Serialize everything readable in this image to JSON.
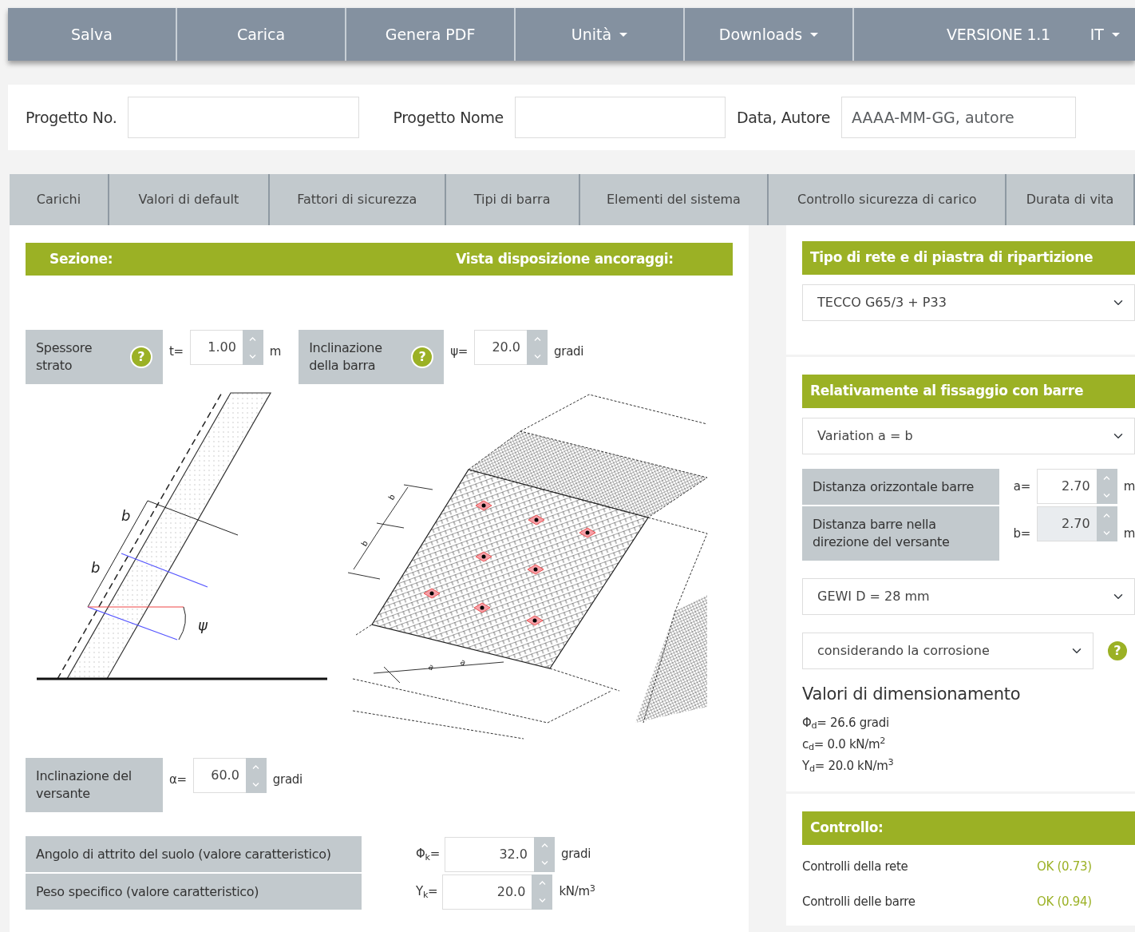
{
  "navbar": {
    "items": [
      {
        "label": "Salva",
        "kind": "button"
      },
      {
        "label": "Carica",
        "kind": "button"
      },
      {
        "label": "Genera PDF",
        "kind": "button"
      },
      {
        "label": "Unità",
        "kind": "dropdown"
      },
      {
        "label": "Downloads",
        "kind": "dropdown"
      }
    ],
    "version": "VERSIONE 1.1",
    "language": {
      "label": "IT",
      "kind": "dropdown"
    }
  },
  "project": {
    "fields": [
      {
        "label": "Progetto No."
      },
      {
        "label": "Progetto Nome"
      },
      {
        "label": "Data, Autore",
        "placeholder": "AAAA-MM-GG, autore"
      }
    ]
  },
  "tabs": [
    {
      "label": "Carichi",
      "selected": false
    },
    {
      "label": "Valori di default",
      "selected": false
    },
    {
      "label": "Fattori di sicurezza",
      "selected": false
    },
    {
      "label": "Tipi di barra",
      "selected": false
    },
    {
      "label": "Elementi del sistema",
      "selected": false
    },
    {
      "label": "Controllo sicurezza di carico",
      "selected": false
    },
    {
      "label": "Durata di vita",
      "selected": false
    }
  ],
  "left_panel": {
    "header": [
      "Sezione:",
      "Vista disposizione ancoraggi:"
    ],
    "params": [
      {
        "label": "Spessore strato",
        "help": "?",
        "symbol": "t=",
        "value": "1.00",
        "unit": "m"
      },
      {
        "label": "Inclinazione della barra",
        "help": "?",
        "symbol": "ψ=",
        "value": "20.0",
        "unit": "gradi"
      }
    ],
    "section_drawing": {
      "labels": [
        "b",
        "b",
        "ψ"
      ]
    },
    "layout_drawing": {
      "labels": [
        "b",
        "b",
        "a",
        "a"
      ]
    },
    "slope": {
      "label": "Inclinazione del versante",
      "symbol": "α=",
      "value": "60.0",
      "unit": "gradi"
    },
    "soil": [
      {
        "label": "Angolo di attrito del suolo (valore caratteristico)",
        "symbol": "Φ$_{k}$=",
        "value": "32.0",
        "unit": "gradi"
      },
      {
        "label": "Peso specifico (valore caratteristico)",
        "symbol": "Y$_{k}$=",
        "value": "20.0",
        "unit": "kN/m$^{3}$"
      }
    ]
  },
  "mesh": {
    "title": "Tipo di rete e di piastra di ripartizione",
    "selection": "TECCO G65/3 + P33"
  },
  "fixing": {
    "title": "Relativamente al fissaggio con barre",
    "variation": "Variation a = b",
    "distances": [
      {
        "label": "Distanza orizzontale barre",
        "symbol": "a=",
        "value": "2.70",
        "unit": "m",
        "disabled": false
      },
      {
        "label": "Distanza barre nella direzione del versante",
        "symbol": "b=",
        "value": "2.70",
        "unit": "m",
        "disabled": true
      }
    ],
    "bar": "GEWI D = 28 mm",
    "corrosion": "considerando la corrosione",
    "help": "?",
    "design_title": "Valori di dimensionamento",
    "design_values": [
      "Φ$_{d}$= 26.6 gradi",
      "c$_{d}$= 0.0 kN/m$^{2}$",
      "Y$_{d}$= 20.0 kN/m$^{3}$"
    ]
  },
  "check": {
    "title": "Controllo:",
    "rows": [
      {
        "label": "Controlli della rete",
        "result": "OK (0.73)"
      },
      {
        "label": "Controlli delle barre",
        "result": "OK (0.94)"
      }
    ]
  }
}
